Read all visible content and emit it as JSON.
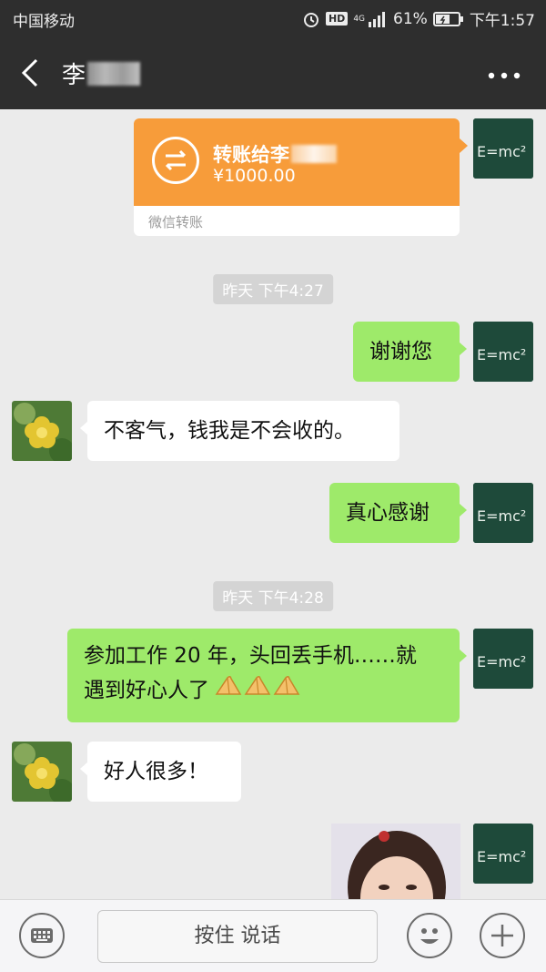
{
  "status_bar": {
    "carrier": "中国移动",
    "hd": "HD",
    "network": "4G",
    "battery": "61%",
    "time": "下午1:57"
  },
  "header": {
    "title": "李"
  },
  "transfer": {
    "label": "转账给李",
    "amount": "¥1000.00",
    "footer": "微信转账"
  },
  "messages": [
    {
      "type": "timestamp",
      "text": "昨天 下午4:27"
    },
    {
      "type": "sent",
      "text": "谢谢您"
    },
    {
      "type": "received",
      "text": "不客气，钱我是不会收的。"
    },
    {
      "type": "sent",
      "text": "真心感谢"
    },
    {
      "type": "timestamp",
      "text": "昨天 下午4:28"
    },
    {
      "type": "sent",
      "line1": "参加工作 20 年，头回丢手机……就",
      "line2": "遇到好心人了",
      "emoji": [
        "pray-hands",
        "pray-hands",
        "pray-hands"
      ]
    },
    {
      "type": "received",
      "text": "好人很多！"
    }
  ],
  "avatar_me_text": "E=mc²",
  "bottom_bar": {
    "voice_label": "按住 说话",
    "icons": [
      "keyboard-icon",
      "emoji-icon",
      "plus-icon"
    ]
  },
  "colors": {
    "bar_bg": "#2e2e2e",
    "chat_bg": "#ebebeb",
    "sent_bubble": "#9eea6a",
    "received_bubble": "#ffffff",
    "transfer_orange": "#f79c3a"
  }
}
